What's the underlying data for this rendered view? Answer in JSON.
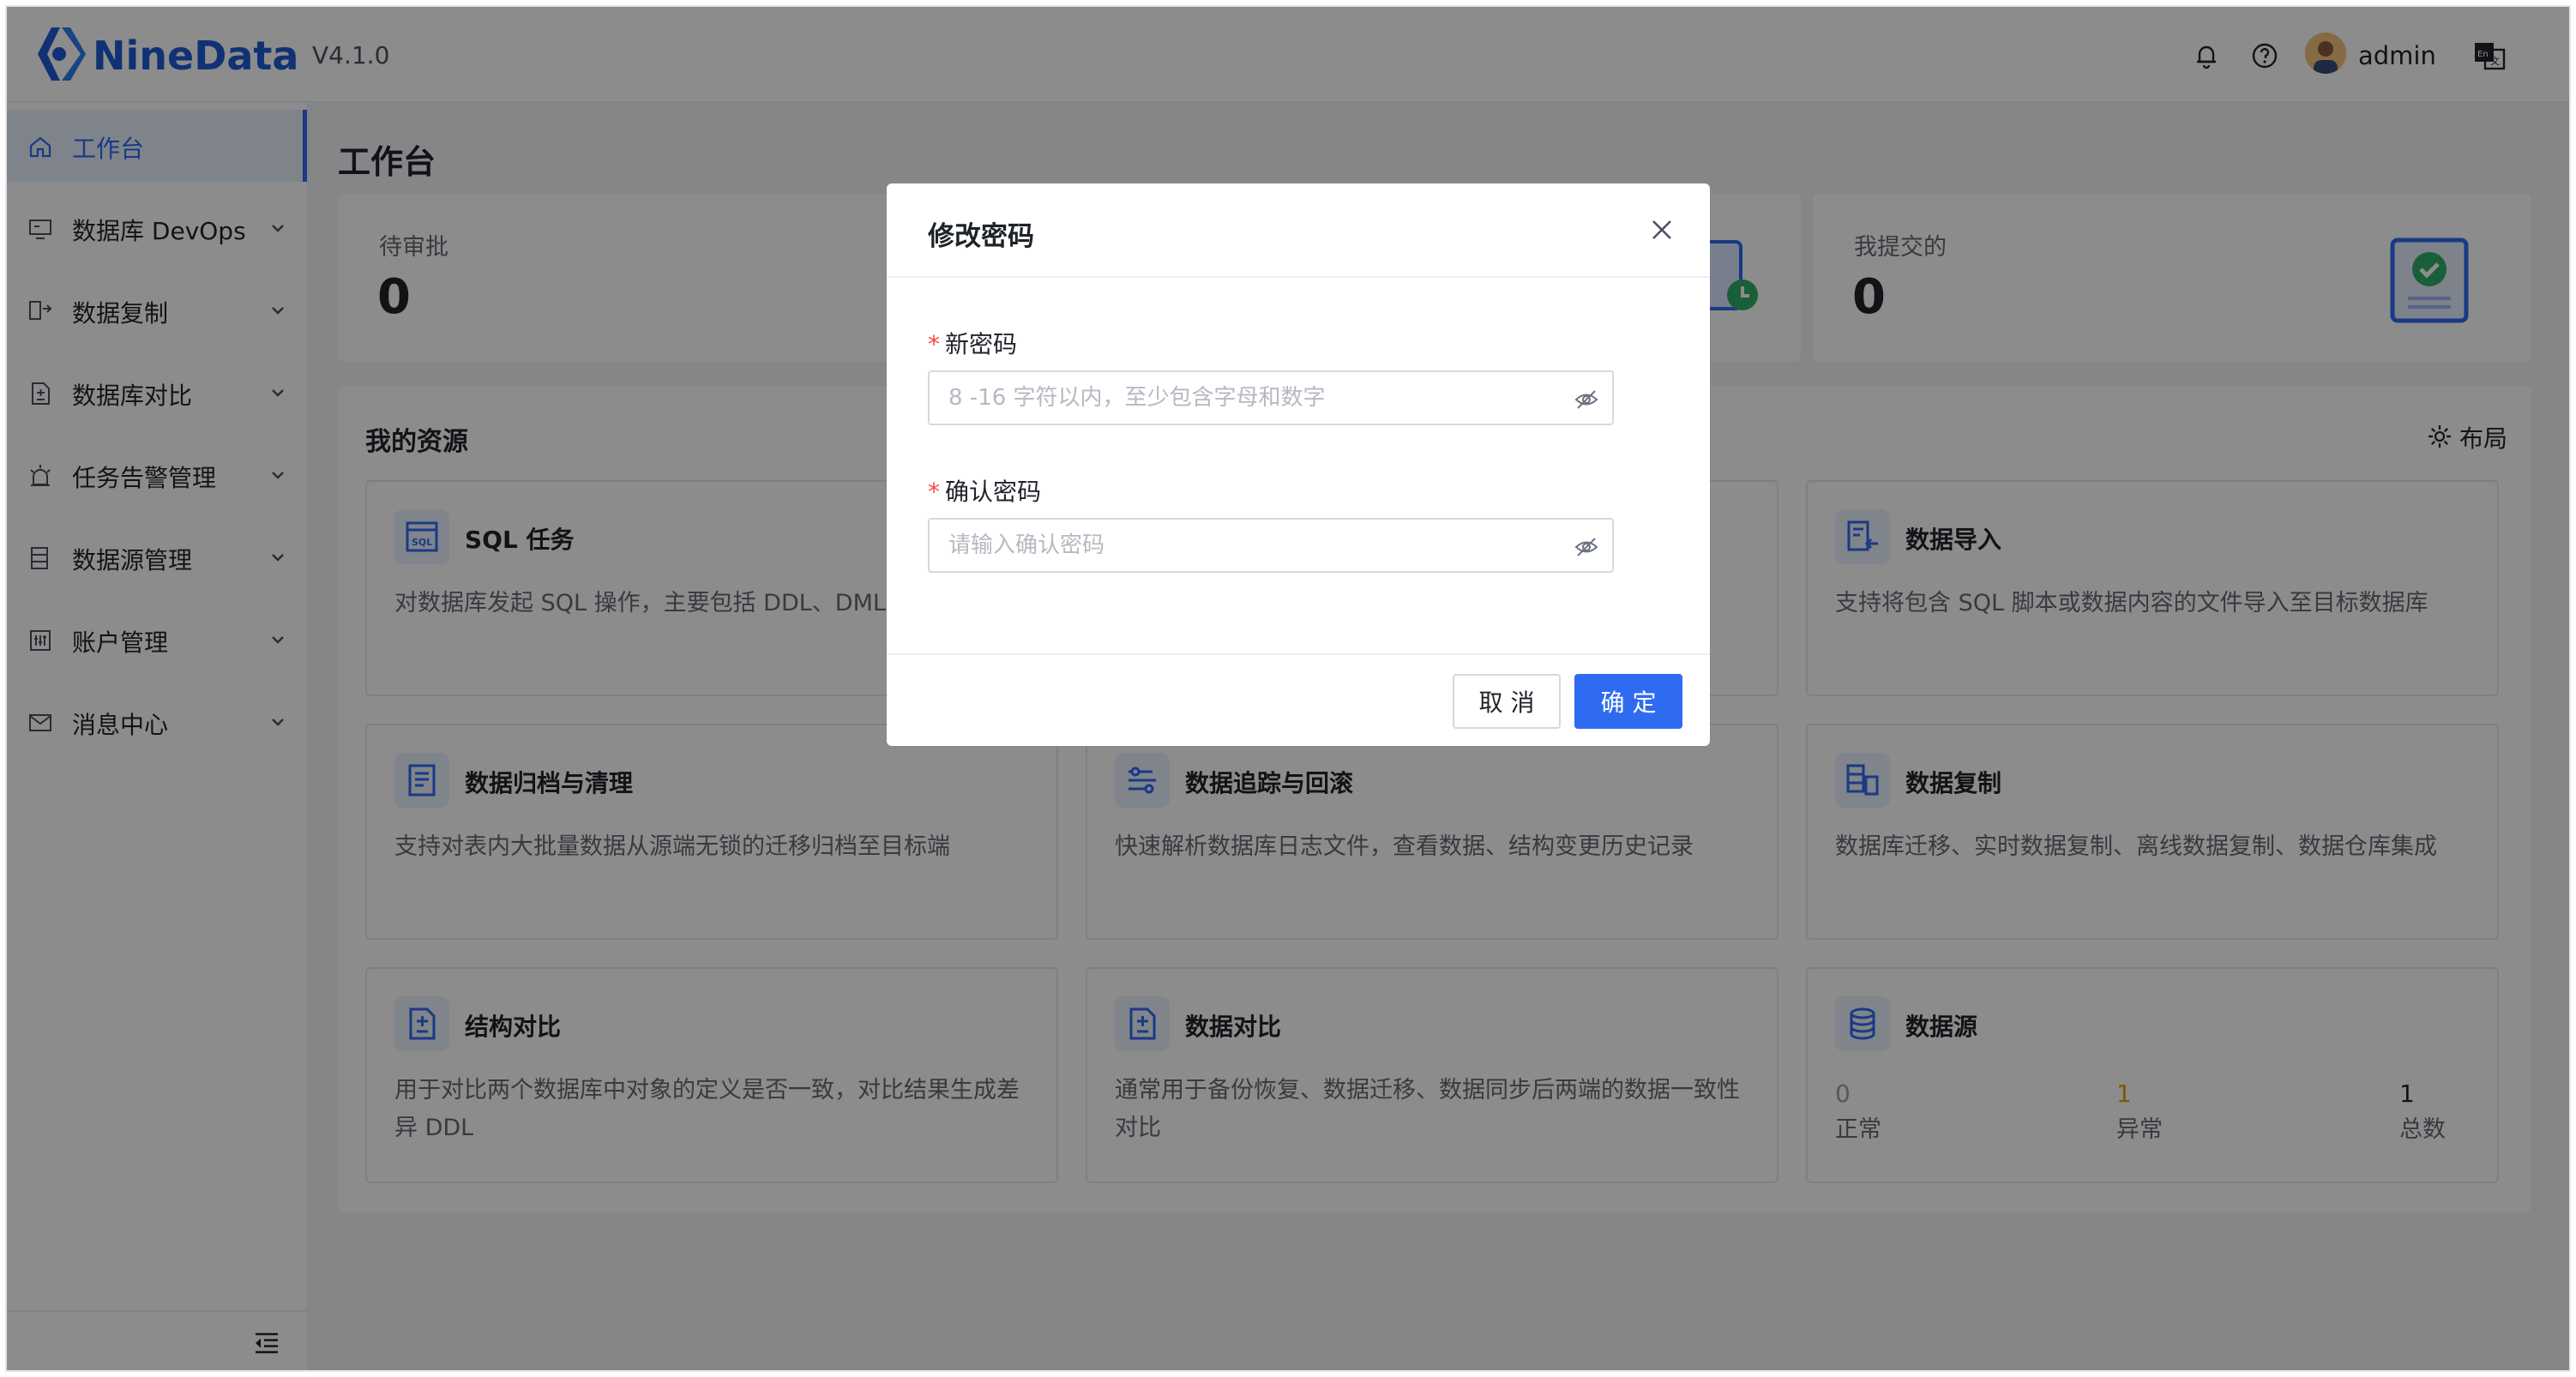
{
  "header": {
    "brand": "NineData",
    "version": "V4.1.0",
    "username": "admin",
    "icons": [
      "nine-data-logo-icon",
      "bell-icon",
      "help-icon",
      "avatar",
      "language-switch-icon"
    ]
  },
  "sidebar": {
    "items": [
      {
        "label": "工作台",
        "icon": "home-icon",
        "active": true
      },
      {
        "label": "数据库 DevOps",
        "icon": "monitor-icon",
        "expandable": true
      },
      {
        "label": "数据复制",
        "icon": "replication-icon",
        "expandable": true
      },
      {
        "label": "数据库对比",
        "icon": "compare-icon",
        "expandable": true
      },
      {
        "label": "任务告警管理",
        "icon": "alarm-icon",
        "expandable": true
      },
      {
        "label": "数据源管理",
        "icon": "datasource-icon",
        "expandable": true
      },
      {
        "label": "账户管理",
        "icon": "account-icon",
        "expandable": true
      },
      {
        "label": "消息中心",
        "icon": "mail-icon",
        "expandable": true
      }
    ],
    "collapse_icon": "collapse-sidebar-icon"
  },
  "main": {
    "title": "工作台",
    "stats": [
      {
        "label": "待审批",
        "value": "0"
      },
      {
        "label": "我提交的",
        "value": "0"
      }
    ],
    "resources": {
      "title": "我的资源",
      "layout_label": "布局",
      "cards": [
        {
          "title": "SQL 任务",
          "desc": "对数据库发起 SQL 操作，主要包括 DDL、DML"
        },
        {
          "title": "数据导入",
          "desc": "支持将包含 SQL 脚本或数据内容的文件导入至目标数据库"
        },
        {
          "title": "数据归档与清理",
          "desc": "支持对表内大批量数据从源端无锁的迁移归档至目标端"
        },
        {
          "title": "数据追踪与回滚",
          "desc": "快速解析数据库日志文件，查看数据、结构变更历史记录"
        },
        {
          "title": "数据复制",
          "desc": "数据库迁移、实时数据复制、离线数据复制、数据仓库集成"
        },
        {
          "title": "结构对比",
          "desc": "用于对比两个数据库中对象的定义是否一致，对比结果生成差异 DDL"
        },
        {
          "title": "数据对比",
          "desc": "通常用于备份恢复、数据迁移、数据同步后两端的数据一致性对比"
        },
        {
          "title": "数据源",
          "desc": ""
        }
      ],
      "datasource_stats": [
        {
          "value": "0",
          "label": "正常",
          "color": "#9aa0aa"
        },
        {
          "value": "1",
          "label": "异常",
          "color": "#e0a100"
        },
        {
          "value": "1",
          "label": "总数",
          "color": "#1f2329"
        }
      ]
    }
  },
  "modal": {
    "title": "修改密码",
    "new_password": {
      "label": "新密码",
      "placeholder": "8 -16 字符以内，至少包含字母和数字",
      "value": ""
    },
    "confirm_password": {
      "label": "确认密码",
      "placeholder": "请输入确认密码",
      "value": ""
    },
    "required_mark": "*",
    "cancel_label": "取 消",
    "ok_label": "确 定"
  },
  "colors": {
    "brand": "#1e5cd6",
    "primary": "#2f6bf0",
    "required": "#f54a45",
    "warning": "#e0a100",
    "mask": "rgba(0,0,0,0.45)"
  }
}
